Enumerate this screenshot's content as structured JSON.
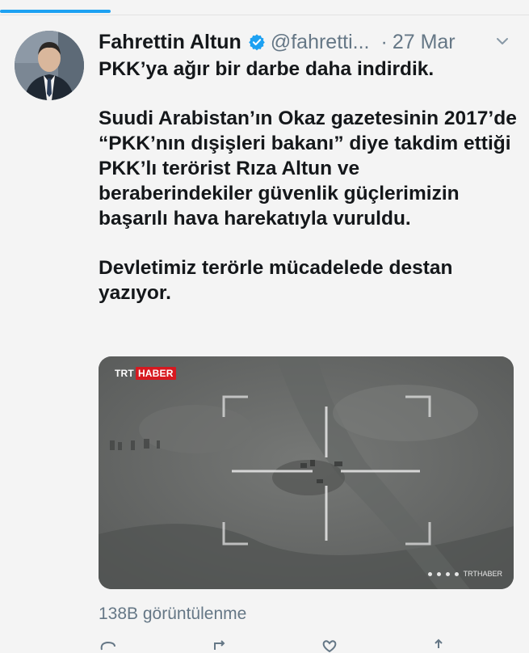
{
  "tweet": {
    "author_name": "Fahrettin Altun",
    "handle": "@fahretti...",
    "separator": "·",
    "date": "27 Mar",
    "paragraphs": [
      "PKK’ya ağır bir darbe daha indirdik.",
      "Suudi Arabistan’ın Okaz gazetesinin 2017’de “PKK’nın dışişleri bakanı” diye takdim ettiği PKK’lı terörist Rıza Altun ve beraberindekiler güvenlik güçlerimizin başarılı hava harekatıyla vuruldu.",
      "Devletimiz terörle mücadelede destan yazıyor."
    ],
    "views": "138B görüntülenme"
  },
  "media": {
    "brand_trt": "TRT",
    "brand_haber": "HABER",
    "credit": "TRTHABER"
  },
  "icons": {
    "verified": "verified-badge-icon",
    "more": "chevron-down-icon"
  },
  "colors": {
    "accent": "#1da1f2",
    "text": "#14171a",
    "muted": "#657786",
    "brand_red": "#d71920"
  }
}
